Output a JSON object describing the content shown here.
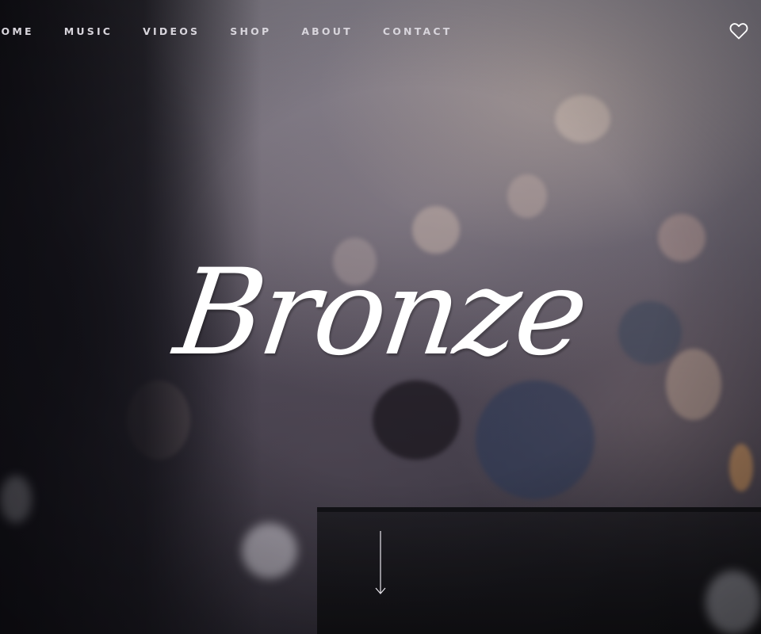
{
  "nav": {
    "items": [
      {
        "label": "LCOME",
        "name": "nav-welcome"
      },
      {
        "label": "MUSIC",
        "name": "nav-music"
      },
      {
        "label": "VIDEOS",
        "name": "nav-videos"
      },
      {
        "label": "SHOP",
        "name": "nav-shop"
      },
      {
        "label": "ABOUT",
        "name": "nav-about"
      },
      {
        "label": "CONTACT",
        "name": "nav-contact"
      }
    ]
  },
  "hero": {
    "title": "Bronze"
  },
  "icons": {
    "favorite": "heart-icon",
    "scroll": "arrow-down-icon"
  },
  "colors": {
    "text": "#ffffff",
    "nav_text": "#d8d5dc"
  }
}
